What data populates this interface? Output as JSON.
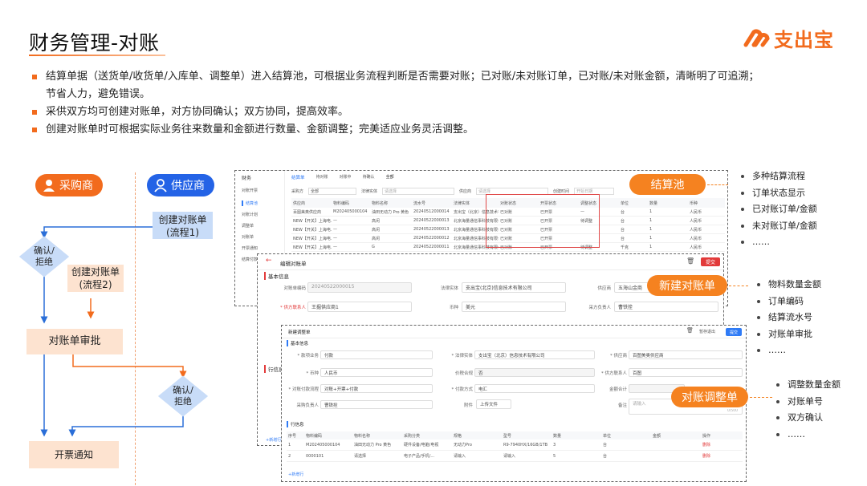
{
  "page": {
    "title": "财务管理-对账",
    "logo_text": "支出宝",
    "bullets": [
      "结算单据（送货单/收货单/入库单、调整单）进入结算池，可根据业务流程判断是否需要对账；已对账/未对账订单，已对账/未对账金额，清晰明了可追溯；",
      "节省人力，避免错误。",
      "采供双方均可创建对账单，对方协同确认；双方协同，提高效率。",
      "创建对账单时可根据实际业务往来数量和金额进行数量、金额调整；完美适应业务灵活调整。"
    ]
  },
  "flow": {
    "buyer_label": "采购商",
    "supplier_label": "供应商",
    "supplier_create": "创建对账单\n(流程1)",
    "confirm_reject_1": "确认/\n拒绝",
    "buyer_create": "创建对账单\n(流程2)",
    "review": "对账单审批",
    "confirm_reject_2": "确认/\n拒绝",
    "invoice_notice": "开票通知"
  },
  "tags": {
    "settle_pool": "结算池",
    "new_statement": "新建对账单",
    "adjust": "对账调整单"
  },
  "annotations": {
    "pool": [
      "多种结算流程",
      "订单状态显示",
      "已对账订单/金额",
      "未对账订单/金额",
      "……"
    ],
    "statement": [
      "物料数量金额",
      "订单编码",
      "结算流水号",
      "对账单审批",
      "……"
    ],
    "adjust": [
      "调整数量金额",
      "对账单号",
      "双方确认",
      "……"
    ]
  },
  "pool_screen": {
    "sidebar_title": "财务",
    "sidebar_items": [
      "对账开票",
      "结算池",
      "对账计划",
      "调整单",
      "对账单",
      "开票通知",
      "结算付款"
    ],
    "tabs": [
      "结算单",
      "待对账",
      "对账中",
      "待确认",
      "全部"
    ],
    "filters": [
      "采购方",
      "全部",
      "法律实体",
      "请选择",
      "供应商",
      "请选择",
      "创建时间",
      "开始日期"
    ],
    "columns": [
      "供应商",
      "物料编码",
      "物料名称",
      "流水号",
      "法律实体",
      "对账状态",
      "开票状态",
      "调整状态",
      "单位",
      "数量",
      "币种"
    ],
    "rows": [
      [
        "百图美奥供应商",
        "M202405000104",
        "油田无动力 Pro 黄色",
        "20240512000014",
        "支出宝（北京）信息技术有限公司",
        "已对账",
        "已开票",
        "—",
        "台",
        "1",
        "人民币"
      ],
      [
        "NEW【开关】上海电...",
        "—",
        "高闲",
        "20240522000013",
        "北京海量通信事科技有限公司",
        "已对账",
        "已开票",
        "待调整",
        "台",
        "1",
        "人民币"
      ],
      [
        "NEW【开关】上海电...",
        "—",
        "高闲",
        "20240522000013",
        "北京海量通信事科技有限公司",
        "已对账",
        "已开票",
        "",
        "台",
        "1",
        "人民币"
      ],
      [
        "NEW【开关】上海电...",
        "—",
        "高闲",
        "20240522000012",
        "北京海量通信事科技有限公司",
        "已对账",
        "已开票",
        "",
        "台",
        "1",
        "人民币"
      ],
      [
        "NEW【开关】上海电...",
        "—",
        "G",
        "20240522000011",
        "北京海量通信事科技有限公司",
        "已对账",
        "已开票",
        "待调整",
        "千克",
        "1",
        "人民币"
      ],
      [
        "NEW【开关】上海电...",
        "—",
        "299",
        "20240522000010",
        "北京海量通信事科技有限公司",
        "已对账",
        "已开票",
        "待调整",
        "台",
        "1",
        "人民币"
      ]
    ]
  },
  "statement_screen": {
    "header": "编辑对账单",
    "submit": "提交",
    "section": "基本信息",
    "f_code_label": "对账单编码",
    "f_code_value": "20240522000015",
    "f_entity_label": "法律实体",
    "f_entity_value": "支出宝(北京)信息技术有限公司",
    "f_supplier_label": "供应商",
    "f_supplier_value": "五海山金商",
    "f_contact_label": "* 供方联系人",
    "f_contact_value": "王掘供应商1",
    "f_currency_label": "币种",
    "f_currency_value": "美元",
    "f_buyer_label": "采方负责人",
    "f_buyer_value": "曹铁拴",
    "line_section": "行信息",
    "add_row": "+新增行"
  },
  "adjust_screen": {
    "header": "新建调整单",
    "draft": "暂存退出",
    "submit": "提交",
    "section": "基本信息",
    "f_type_label": "* 款项业务",
    "f_type_value": "付款",
    "f_entity_label": "* 法律实体",
    "f_entity_value": "支出宝（北京）信息技术有限公司",
    "f_supplier_label": "* 供应商",
    "f_supplier_value": "百图美奥供应商",
    "f_currency_label": "* 币种",
    "f_currency_value": "人民币",
    "f_tax_label": "价税合规",
    "f_tax_value": "否",
    "f_contact_label": "* 供方联系人",
    "f_contact_value": "百图",
    "f_flow_label": "* 对账付款流程",
    "f_flow_value": "对账+开票+付款",
    "f_paymethod_label": "* 付款方式",
    "f_paymethod_value": "电汇",
    "f_amount_label": "金额合计",
    "f_buyer_label": "采购负责人",
    "f_buyer_value": "曹铁拴",
    "f_attach_label": "附件",
    "upload": "上传文件",
    "f_remark_label": "备注",
    "f_remark_placeholder": "请输入",
    "counter": "0/500",
    "line_section": "行信息",
    "columns": [
      "序号",
      "物料编码",
      "物料名称",
      "采购分类",
      "规格",
      "型号",
      "数量",
      "单位",
      "金额",
      "操作"
    ],
    "rows": [
      [
        "1",
        "M202405000104",
        "油田无动力 Pro 黄色",
        "硬件设备/电脑/电视",
        "无动力Pro",
        "R9-7940HX/16GB/1TB",
        "3",
        "台",
        "",
        "删除"
      ],
      [
        "2",
        "0000101",
        "请选择",
        "电子产品/手机/...",
        "请输入",
        "请输入",
        "5",
        "台",
        "",
        "删除"
      ]
    ],
    "add_row": "+新增行"
  }
}
